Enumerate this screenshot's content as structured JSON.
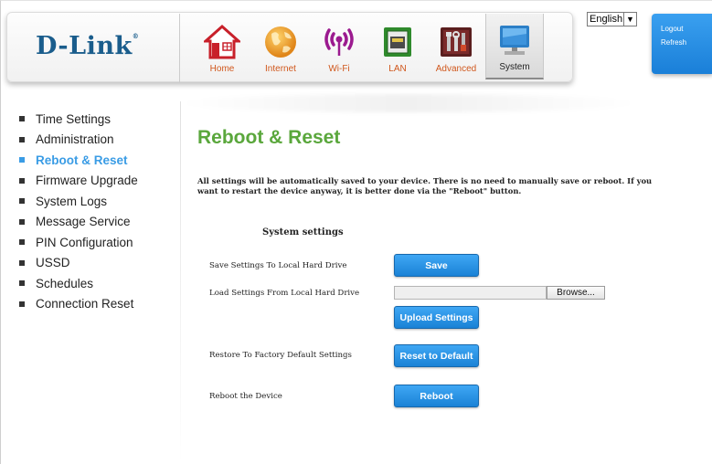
{
  "brand": {
    "logo_text": "D-Link",
    "logo_mark": "®"
  },
  "nav": {
    "items": [
      {
        "label": "Home",
        "icon": "home-icon"
      },
      {
        "label": "Internet",
        "icon": "globe-icon"
      },
      {
        "label": "Wi-Fi",
        "icon": "wifi-icon"
      },
      {
        "label": "LAN",
        "icon": "lan-port-icon"
      },
      {
        "label": "Advanced",
        "icon": "tools-icon"
      },
      {
        "label": "System",
        "icon": "computer-icon"
      }
    ],
    "active": "System"
  },
  "language": {
    "selected": "English"
  },
  "account_links": {
    "logout": "Logout",
    "refresh": "Refresh"
  },
  "sidebar": {
    "items": [
      {
        "label": "Time Settings"
      },
      {
        "label": "Administration"
      },
      {
        "label": "Reboot & Reset"
      },
      {
        "label": "Firmware Upgrade"
      },
      {
        "label": "System Logs"
      },
      {
        "label": "Message Service"
      },
      {
        "label": "PIN Configuration"
      },
      {
        "label": "USSD"
      },
      {
        "label": "Schedules"
      },
      {
        "label": "Connection Reset"
      }
    ],
    "active": "Reboot & Reset"
  },
  "main": {
    "title": "Reboot & Reset",
    "intro": "All settings will be automatically saved to your device. There is no need to manually save or reboot. If you want to restart the device anyway, it is better done via the \"Reboot\" button.",
    "section_title": "System settings",
    "rows": {
      "save": {
        "label": "Save Settings To Local Hard Drive",
        "button": "Save"
      },
      "load": {
        "label": "Load Settings From Local Hard Drive",
        "file_value": "",
        "browse": "Browse...",
        "button": "Upload Settings"
      },
      "restore": {
        "label": "Restore To Factory Default Settings",
        "button": "Reset to Default"
      },
      "reboot": {
        "label": "Reboot the Device",
        "button": "Reboot"
      }
    }
  },
  "colors": {
    "accent_blue": "#2a8fe6",
    "title_green": "#5aa73c",
    "brand_blue": "#1a5d8c",
    "nav_label_orange": "#d0571c"
  }
}
